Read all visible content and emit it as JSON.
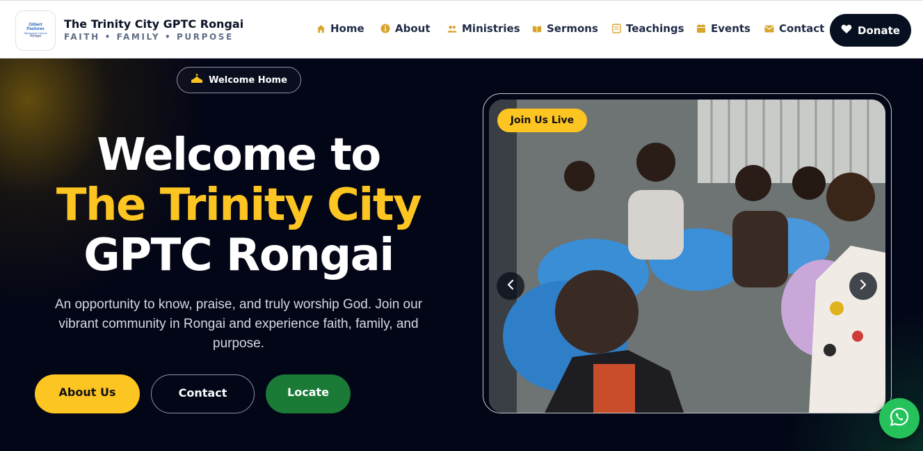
{
  "site": {
    "name": "The Trinity City GPTC Rongai",
    "tagline": "FAITH • FAMILY • PURPOSE",
    "logo_text": [
      "Gilbert",
      "Pastures",
      "Tabernacle Church",
      "Rongai"
    ]
  },
  "nav": {
    "items": [
      {
        "label": "Home",
        "icon": "home-icon"
      },
      {
        "label": "About",
        "icon": "info-icon"
      },
      {
        "label": "Ministries",
        "icon": "people-icon"
      },
      {
        "label": "Sermons",
        "icon": "book-icon"
      },
      {
        "label": "Teachings",
        "icon": "notes-icon"
      },
      {
        "label": "Events",
        "icon": "calendar-icon"
      },
      {
        "label": "Contact",
        "icon": "mail-icon"
      }
    ],
    "donate_label": "Donate",
    "accent": "#d9a42a"
  },
  "hero": {
    "pill_label": "Welcome Home",
    "heading_line1": "Welcome to",
    "heading_line2": "The Trinity City",
    "heading_line3": "GPTC Rongai",
    "description": "An opportunity to know, praise, and truly worship God. Join our vibrant community in Rongai and experience faith, family, and purpose.",
    "buttons": {
      "about": "About Us",
      "contact": "Contact",
      "locate": "Locate"
    },
    "highlight_color": "#fdc521"
  },
  "slider": {
    "badge": "Join Us Live",
    "prev_icon": "chevron-left-icon",
    "next_icon": "chevron-right-icon"
  },
  "floating": {
    "whatsapp_icon": "whatsapp-icon"
  }
}
